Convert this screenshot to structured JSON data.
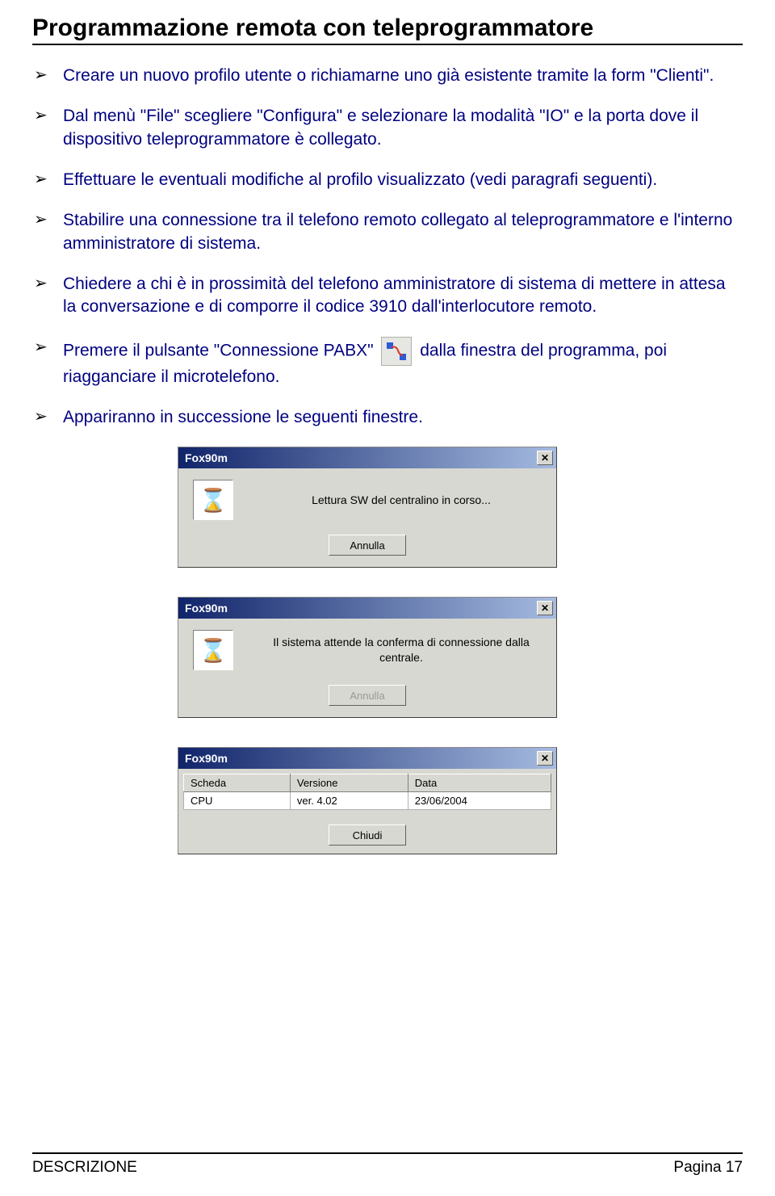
{
  "title": "Programmazione remota con teleprogrammatore",
  "bullets": [
    "Creare un nuovo profilo utente o richiamarne uno già esistente tramite la form \"Clienti\".",
    "Dal menù \"File\" scegliere \"Configura\" e selezionare la modalità \"IO\" e la porta dove il dispositivo teleprogrammatore è collegato.",
    "Effettuare le eventuali modifiche al profilo visualizzato (vedi paragrafi seguenti).",
    "Stabilire una connessione tra il telefono remoto collegato al teleprogrammatore e l'interno amministratore di sistema.",
    "Chiedere a chi è in prossimità del telefono amministratore di sistema di mettere in attesa la conversazione e di comporre il codice 3910 dall'interlocutore remoto."
  ],
  "bullet_conn_pre": "Premere il pulsante \"Connessione PABX\" ",
  "bullet_conn_post": " dalla finestra del programma, poi riagganciare il microtelefono.",
  "bullet_last": "Appariranno in successione le seguenti finestre.",
  "dlg1": {
    "title": "Fox90m",
    "msg": "Lettura SW del centralino in corso...",
    "btn": "Annulla"
  },
  "dlg2": {
    "title": "Fox90m",
    "msg": "Il sistema attende la conferma di connessione dalla centrale.",
    "btn": "Annulla"
  },
  "dlg3": {
    "title": "Fox90m",
    "headers": [
      "Scheda",
      "Versione",
      "Data"
    ],
    "row": [
      "CPU",
      "ver. 4.02",
      "23/06/2004"
    ],
    "btn": "Chiudi"
  },
  "footer_left": "DESCRIZIONE",
  "footer_right": "Pagina 17"
}
